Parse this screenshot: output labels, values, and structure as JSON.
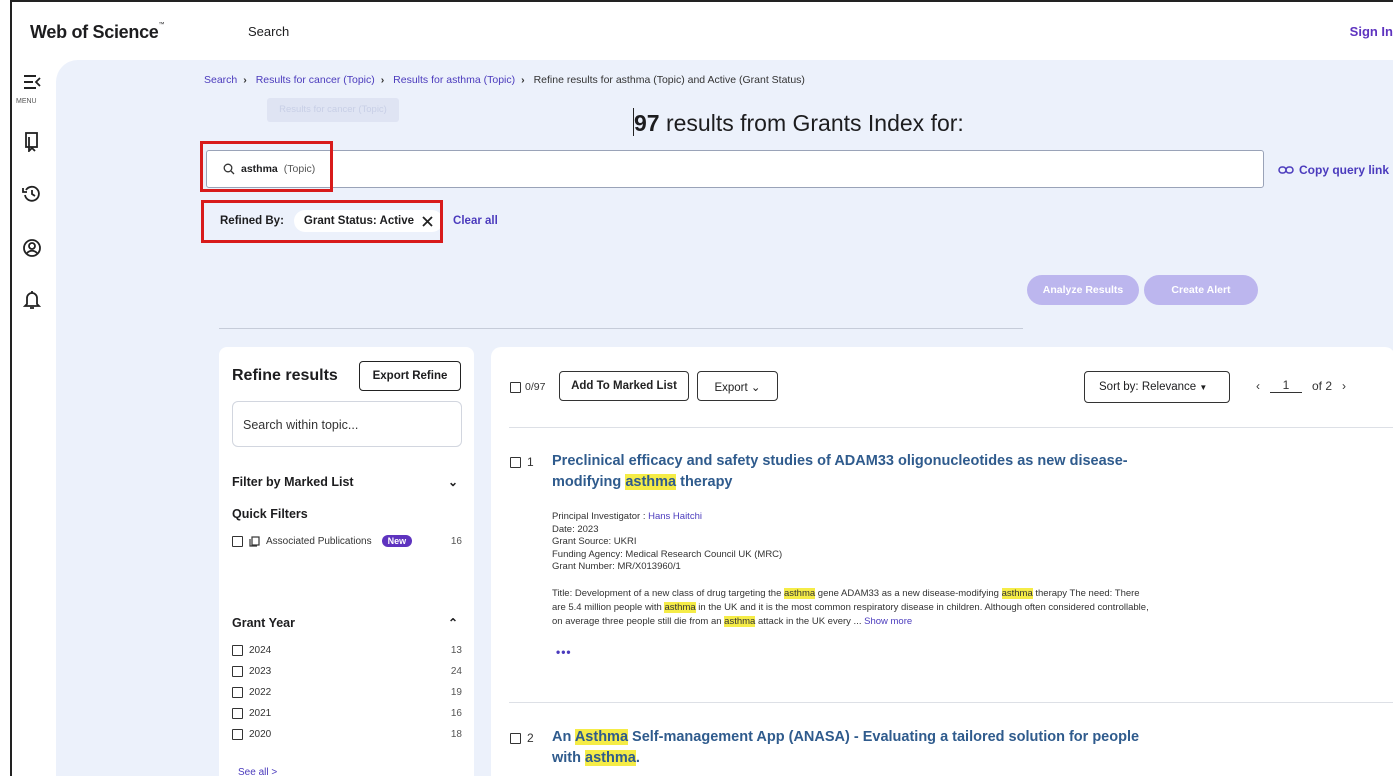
{
  "header": {
    "brand": "Web of Science",
    "brand_tm": "™",
    "search_link": "Search",
    "sign_in": "Sign In"
  },
  "rail": {
    "menu_label": "MENU",
    "icons": [
      "menu-collapse-icon",
      "bookmarks-icon",
      "history-icon",
      "account-icon",
      "bell-icon"
    ]
  },
  "breadcrumb": {
    "items": [
      "Search",
      "Results for cancer (Topic)",
      "Results for asthma (Topic)"
    ],
    "current": "Refine results for asthma (Topic) and Active (Grant Status)",
    "tooltip": "Results for cancer (Topic)"
  },
  "summary": {
    "count": "97",
    "text": " results from Grants Index for:"
  },
  "query": {
    "term": "asthma",
    "field": "(Topic)",
    "copy_link": "Copy query link"
  },
  "refined": {
    "label": "Refined By:",
    "chip": "Grant Status: Active",
    "clear_all": "Clear all"
  },
  "actions": {
    "analyze": "Analyze Results",
    "alert": "Create Alert"
  },
  "refine_panel": {
    "title": "Refine results",
    "export": "Export Refine",
    "search_placeholder": "Search within topic...",
    "marked_list": "Filter by Marked List",
    "quick_filters": "Quick Filters",
    "assoc_pubs": "Associated Publications",
    "new_badge": "New",
    "assoc_count": "16",
    "grant_year": "Grant Year",
    "years": [
      {
        "label": "2024",
        "count": "13"
      },
      {
        "label": "2023",
        "count": "24"
      },
      {
        "label": "2022",
        "count": "19"
      },
      {
        "label": "2021",
        "count": "16"
      },
      {
        "label": "2020",
        "count": "18"
      }
    ],
    "see_all": "See all >"
  },
  "toolbar": {
    "selected": "0/97",
    "add_marked": "Add To Marked List",
    "export": "Export",
    "sort": "Sort by: Relevance",
    "page": "1",
    "of_pages": "of 2"
  },
  "results": [
    {
      "num": "1",
      "title_a": "Preclinical efficacy and safety studies of ADAM33 oligonucleotides as new disease-modifying ",
      "title_hl": "asthma",
      "title_b": " therapy",
      "pi_label": "Principal Investigator : ",
      "pi": "Hans Haitchi",
      "date": "Date: 2023",
      "source": "Grant Source: UKRI",
      "agency": "Funding Agency: Medical Research Council UK (MRC)",
      "number": "Grant Number: MR/X013960/1",
      "abs_1": "Title: Development of a new class of drug targeting the ",
      "abs_hl1": "asthma",
      "abs_2": " gene ADAM33 as a new disease-modifying ",
      "abs_hl2": "asthma",
      "abs_3": " therapy The need: There are 5.4 million people with ",
      "abs_hl3": "asthma",
      "abs_4": " in the UK and it is the most common respiratory disease in children. Although often considered controllable, on average three people still die from an ",
      "abs_hl4": "asthma",
      "abs_5": " attack in the UK every  ... ",
      "show_more": "Show more",
      "dots": "•••"
    },
    {
      "num": "2",
      "title_a": "An ",
      "title_hl": "Asthma",
      "title_b": " Self-management App (ANASA) - Evaluating a tailored solution for people with ",
      "title_hl2": "asthma",
      "title_c": "."
    }
  ]
}
